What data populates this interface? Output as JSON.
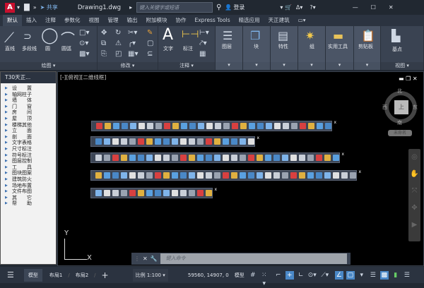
{
  "titlebar": {
    "logo": "A",
    "share": "共享",
    "filename": "Drawing1.dwg",
    "search_placeholder": "键入关键字或短语",
    "login": "登录"
  },
  "tabs": [
    "默认",
    "插入",
    "注释",
    "参数化",
    "视图",
    "管理",
    "输出",
    "附加模块",
    "协作",
    "Express Tools",
    "精选应用",
    "天正建筑"
  ],
  "ribbon": {
    "draw": {
      "title": "绘图",
      "tools": [
        "直线",
        "多段线",
        "圆",
        "圆弧"
      ]
    },
    "modify": {
      "title": "修改"
    },
    "annotation": {
      "title": "注释",
      "tools": [
        "文字",
        "标注"
      ]
    },
    "big": [
      "图层",
      "块",
      "特性",
      "组",
      "实用工具",
      "剪贴板"
    ],
    "view": {
      "title": "视图",
      "tool": "基点"
    }
  },
  "sidebar": {
    "title": "T30天正...",
    "items": [
      "设　　置",
      "轴网柱子",
      "墙　　体",
      "门　　窗",
      "房　　间",
      "屋　　顶",
      "楼梯其他",
      "立　　面",
      "剖　　面",
      "文字表格",
      "尺寸标注",
      "符号标注",
      "图层控制",
      "工　　具",
      "图块图案",
      "建筑防火",
      "场地布置",
      "文件布图",
      "其　　它",
      "帮　　助"
    ]
  },
  "viewport": {
    "label": "[-][俯视][二维线框]",
    "viewcube": {
      "north": "北",
      "south": "南",
      "east": "东",
      "west": "西",
      "top": "上",
      "wcs": "未命名"
    },
    "axis_x": "X",
    "axis_y": "Y"
  },
  "toolbars": [
    {
      "count": 28
    },
    {
      "count": 19
    },
    {
      "count": 29
    },
    {
      "count": 31
    },
    {
      "count": 14
    }
  ],
  "command": {
    "placeholder": "键入命令"
  },
  "status": {
    "tabs": [
      "模型",
      "布局1",
      "布局2"
    ],
    "scale": "比例 1:100",
    "coords": "59560, 14907, 0",
    "mode": "模型"
  },
  "colors": {
    "accent": "#4a88c7",
    "brand": "#c8102e"
  }
}
